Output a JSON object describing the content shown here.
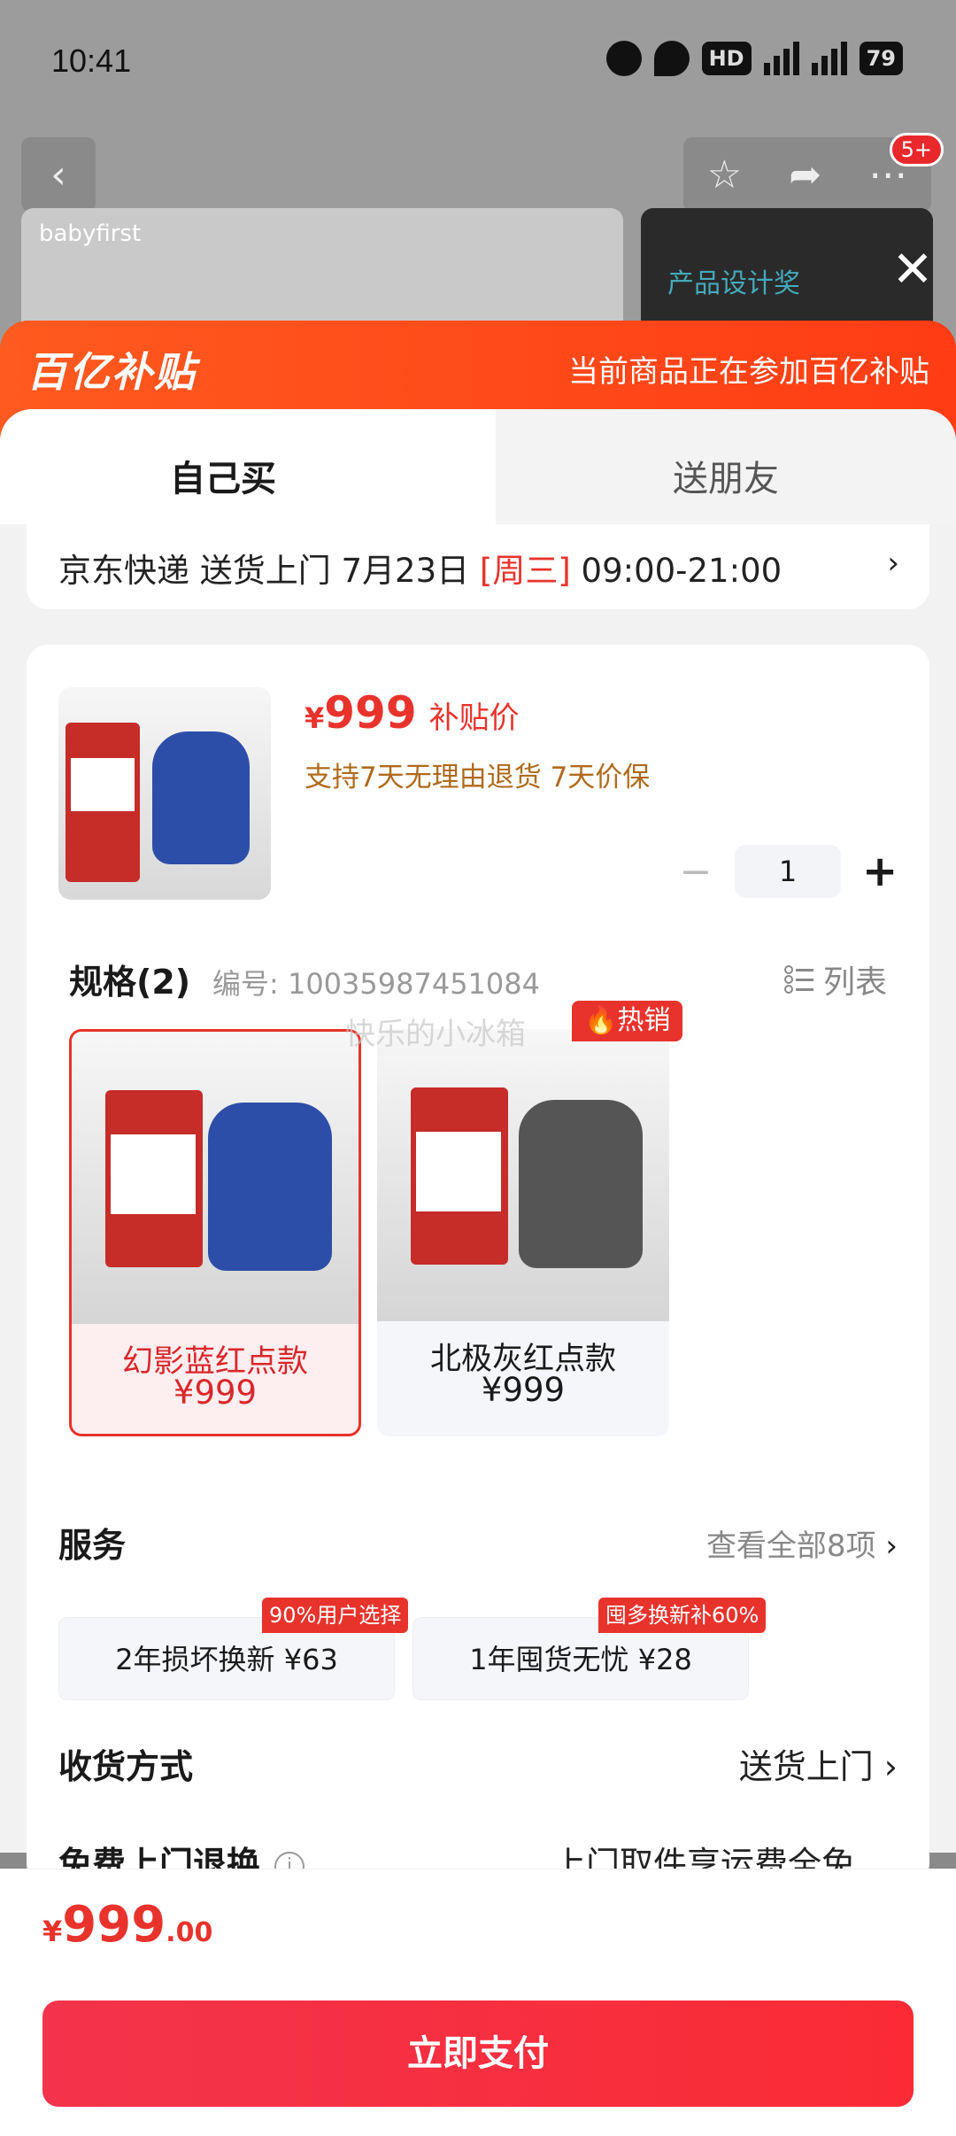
{
  "status_bar": {
    "time": "10:41",
    "hd": "HD",
    "network1": "5G",
    "network2": "5G",
    "battery": "79"
  },
  "header": {
    "back_icon": "chevron-left-icon",
    "badge": "5+"
  },
  "background_product": {
    "brand": "babyfirst",
    "award_text": "产品设计奖"
  },
  "banner": {
    "logo": "百亿补贴",
    "message": "当前商品正在参加百亿补贴"
  },
  "tabs": [
    {
      "label": "自己买",
      "active": true
    },
    {
      "label": "送朋友",
      "active": false
    }
  ],
  "delivery": {
    "prefix": "京东快递 送货上门 7月23日 ",
    "weekday": "[周三]",
    "time_range": " 09:00-21:00"
  },
  "product": {
    "price_symbol": "¥",
    "price": "999",
    "price_label": "补贴价",
    "policy": "支持7天无理由退货  7天价保",
    "quantity": "1"
  },
  "spec": {
    "title": "规格(2)",
    "code": "编号: 10035987451084",
    "list_label": "列表"
  },
  "variants": [
    {
      "name": "幻影蓝红点款",
      "price": "¥999",
      "selected": true
    },
    {
      "name": "北极灰红点款",
      "price": "¥999",
      "selected": false
    }
  ],
  "hot_tag": "热销",
  "watermark": "快乐的小冰箱",
  "services": {
    "title": "服务",
    "view_all": "查看全部8项",
    "items": [
      {
        "label": "2年损坏换新  ¥63",
        "tag": "90%用户选择"
      },
      {
        "label": "1年囤货无忧  ¥28",
        "tag": "囤多换新补60%"
      }
    ]
  },
  "shipping": {
    "title": "收货方式",
    "value": "送货上门"
  },
  "free_return": {
    "title": "免费上门退换",
    "value": "上门取件享运费全免"
  },
  "footer": {
    "currency": "¥",
    "total_int": "999",
    "total_dec": ".00",
    "pay_label": "立即支付"
  },
  "colors": {
    "accent": "#e8332c",
    "banner": "#ff4a1a",
    "pay_button": "#f3334b"
  }
}
